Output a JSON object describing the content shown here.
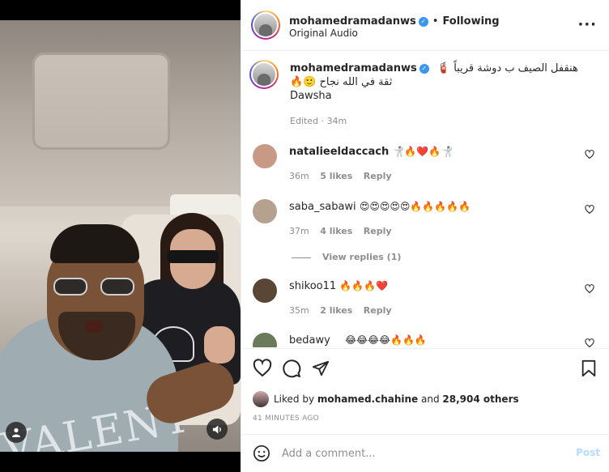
{
  "header": {
    "username": "mohamedramadanws",
    "follow_sep": "•",
    "follow_status": "Following",
    "audio": "Original Audio",
    "more_glyph": "···"
  },
  "caption": {
    "username": "mohamedramadanws",
    "line1": "هنقفل الصيف ب دوشة قريباً 🧯",
    "line2": "ثقة في الله نجاح 🙂🔥",
    "line3": "Dawsha",
    "edited": "Edited · 34m"
  },
  "comments": [
    {
      "username": "natalieeldaccach",
      "text": "🤺🔥❤️🔥🤺",
      "time": "36m",
      "likes": "5 likes",
      "reply": "Reply",
      "avatar_color": "#c79a86"
    },
    {
      "username": "saba_sabawi",
      "text": "😍😍😍😍😍🔥🔥🔥🔥🔥",
      "time": "37m",
      "likes": "4 likes",
      "reply": "Reply",
      "avatar_color": "#b6a08e"
    },
    {
      "username": "shikoo11",
      "text": "🔥🔥🔥❤️",
      "time": "35m",
      "likes": "2 likes",
      "reply": "Reply",
      "avatar_color": "#5a4634"
    },
    {
      "username": "bedawy",
      "text": "😂😂😂😂🔥🔥🔥",
      "avatar_color": "#6b7a5a"
    }
  ],
  "view_replies": "View replies (1)",
  "likes": {
    "prefix": "Liked by",
    "user": "mohamed.chahine",
    "joiner": "and",
    "others": "28,904 others"
  },
  "posted_ago": "41 MINUTES AGO",
  "composer": {
    "placeholder": "Add a comment...",
    "post_label": "Post"
  },
  "video": {
    "shirt_text": "VALENT"
  },
  "colors": {
    "verified": "#3897f0",
    "muted": "#8e8e8e",
    "post_disabled": "#b3dbff"
  },
  "icons": [
    "heart-icon",
    "comment-icon",
    "share-icon",
    "bookmark-icon",
    "smile-icon",
    "user-icon",
    "volume-icon",
    "more-icon",
    "verified-icon"
  ]
}
